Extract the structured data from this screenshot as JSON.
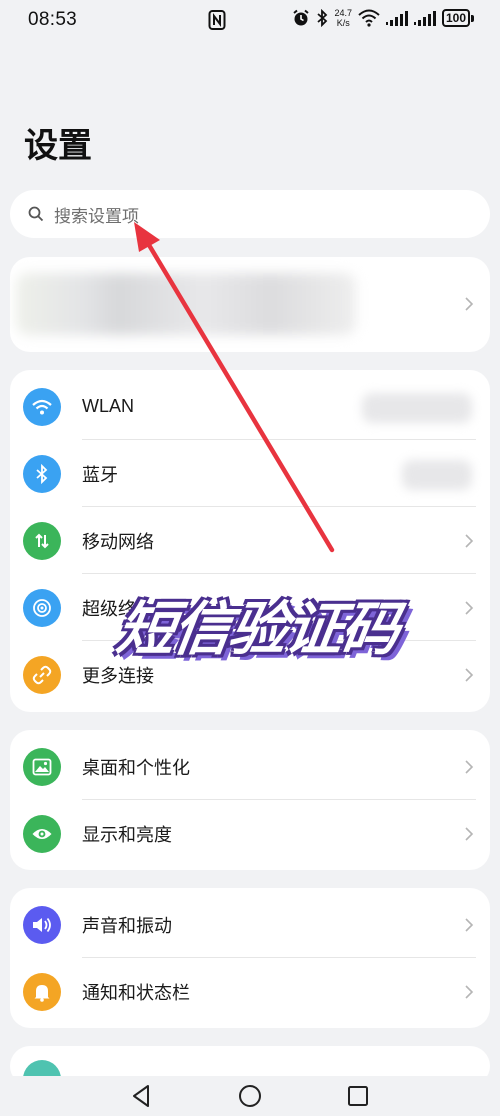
{
  "status_bar": {
    "time": "08:53",
    "speed_value": "24.7",
    "speed_unit": "K/s",
    "battery": "100"
  },
  "page": {
    "title": "设置"
  },
  "search": {
    "placeholder": "搜索设置项"
  },
  "groups": [
    {
      "items": [
        {
          "label": "WLAN",
          "icon": "wifi-icon",
          "color": "#3aa2f2"
        },
        {
          "label": "蓝牙",
          "icon": "bluetooth-icon",
          "color": "#3aa2f2"
        },
        {
          "label": "移动网络",
          "icon": "mobile-data-icon",
          "color": "#3bb55a"
        },
        {
          "label": "超级终",
          "icon": "super-device-icon",
          "color": "#3aa2f2"
        },
        {
          "label": "更多连接",
          "icon": "link-icon",
          "color": "#f4a524"
        }
      ]
    },
    {
      "items": [
        {
          "label": "桌面和个性化",
          "icon": "wallpaper-icon",
          "color": "#3bb55a"
        },
        {
          "label": "显示和亮度",
          "icon": "eye-icon",
          "color": "#3bb55a"
        }
      ]
    },
    {
      "items": [
        {
          "label": "声音和振动",
          "icon": "sound-icon",
          "color": "#5b5bf0"
        },
        {
          "label": "通知和状态栏",
          "icon": "bell-icon",
          "color": "#f4a524"
        }
      ]
    }
  ],
  "overlay": {
    "text": "短信验证码"
  },
  "colors": {
    "background": "#f1f2f4",
    "card": "#ffffff",
    "arrow": "#e8343f",
    "overlay_outline": "#4a2f8f",
    "overlay_shadow": "#7e64d8"
  }
}
